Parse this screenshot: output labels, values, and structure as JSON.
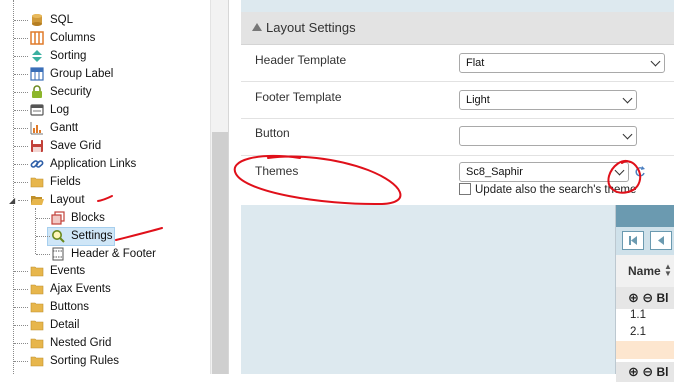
{
  "tree": {
    "items": [
      {
        "label": "SQL",
        "icon": "database-icon"
      },
      {
        "label": "Columns",
        "icon": "columns-icon"
      },
      {
        "label": "Sorting",
        "icon": "sort-icon"
      },
      {
        "label": "Group Label",
        "icon": "group-label-icon"
      },
      {
        "label": "Security",
        "icon": "lock-icon"
      },
      {
        "label": "Log",
        "icon": "log-icon"
      },
      {
        "label": "Gantt",
        "icon": "gantt-chart-icon"
      },
      {
        "label": "Save Grid",
        "icon": "save-icon"
      },
      {
        "label": "Application Links",
        "icon": "link-icon"
      },
      {
        "label": "Fields",
        "icon": "folder-icon"
      },
      {
        "label": "Layout",
        "icon": "folder-open-icon"
      },
      {
        "label": "Blocks",
        "icon": "blocks-icon"
      },
      {
        "label": "Settings",
        "icon": "magnifier-icon"
      },
      {
        "label": "Header & Footer",
        "icon": "header-footer-icon"
      },
      {
        "label": "Events",
        "icon": "folder-icon"
      },
      {
        "label": "Ajax Events",
        "icon": "folder-icon"
      },
      {
        "label": "Buttons",
        "icon": "folder-icon"
      },
      {
        "label": "Detail",
        "icon": "folder-icon"
      },
      {
        "label": "Nested Grid",
        "icon": "folder-icon"
      },
      {
        "label": "Sorting Rules",
        "icon": "folder-icon"
      }
    ]
  },
  "panel": {
    "title": "Layout Settings",
    "rows": [
      {
        "label": "Header Template",
        "value": "Flat"
      },
      {
        "label": "Footer Template",
        "value": "Light"
      },
      {
        "label": "Button",
        "value": ""
      },
      {
        "label": "Themes",
        "value": "Sc8_Saphir"
      }
    ],
    "themes_checkbox_label": "Update also the search's theme"
  },
  "preview": {
    "column_name": "Name",
    "group_label": "Bl",
    "cells": [
      "1.1",
      "2.1"
    ]
  },
  "colors": {
    "accent_blue": "#6b9ab0",
    "preview_bg": "#dde9ef",
    "annotation_red": "#e0101a",
    "selected_bg": "#cfe6f7"
  }
}
